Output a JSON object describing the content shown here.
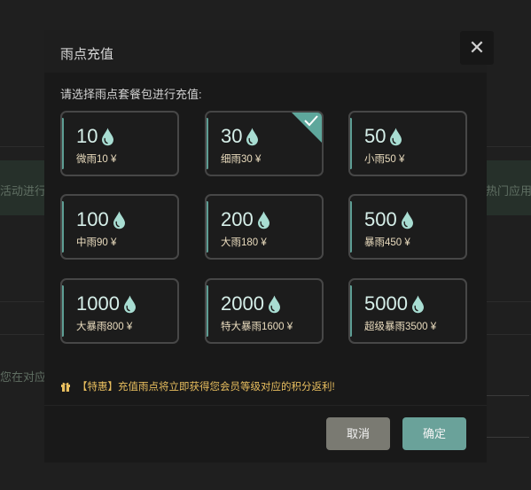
{
  "background": {
    "banner_left_text": "活动进行",
    "banner_right_text": "热门应用",
    "side_text": "您在对应域"
  },
  "dialog": {
    "title": "雨点充值",
    "close_glyph": "✕",
    "prompt": "请选择雨点套餐包进行充值:",
    "packages": [
      {
        "amount": "10",
        "name": "微雨10 ¥",
        "selected": false
      },
      {
        "amount": "30",
        "name": "细雨30 ¥",
        "selected": true
      },
      {
        "amount": "50",
        "name": "小雨50 ¥",
        "selected": false
      },
      {
        "amount": "100",
        "name": "中雨90 ¥",
        "selected": false
      },
      {
        "amount": "200",
        "name": "大雨180 ¥",
        "selected": false
      },
      {
        "amount": "500",
        "name": "暴雨450 ¥",
        "selected": false
      },
      {
        "amount": "1000",
        "name": "大暴雨800 ¥",
        "selected": false
      },
      {
        "amount": "2000",
        "name": "特大暴雨1600 ¥",
        "selected": false
      },
      {
        "amount": "5000",
        "name": "超级暴雨3500 ¥",
        "selected": false
      }
    ],
    "promo_text": "【特惠】充值雨点将立即获得您会员等级对应的积分返利!",
    "cancel_label": "取消",
    "confirm_label": "确定"
  },
  "colors": {
    "accent": "#6aa29a",
    "drop": "#a8ddd2",
    "promo": "#e9bf5f"
  },
  "icons": {
    "drop": "raindrop-icon",
    "check": "check-icon",
    "gift": "gift-icon",
    "close": "close-icon"
  }
}
